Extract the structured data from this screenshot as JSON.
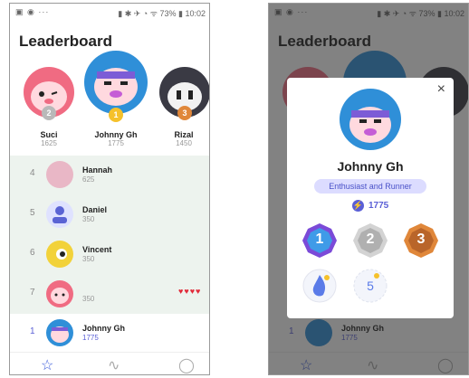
{
  "status_bar": {
    "left_icons": "▣ ◉ ···",
    "battery": "73%",
    "time": "10:02"
  },
  "title": "Leaderboard",
  "podium": [
    {
      "name": "Suci",
      "score": "1625",
      "rank": "2",
      "avatar_color": "#f06b82",
      "medal_color": "#b9b9b9"
    },
    {
      "name": "Johnny Gh",
      "score": "1775",
      "rank": "1",
      "avatar_color": "#2f8fd8",
      "medal_color": "#f5c12b"
    },
    {
      "name": "Rizal",
      "score": "1450",
      "rank": "3",
      "avatar_color": "#3a3a44",
      "medal_color": "#e0873a"
    }
  ],
  "list": [
    {
      "rank": "4",
      "name": "Hannah",
      "score": "625",
      "avatar_color": "#e9b7c6"
    },
    {
      "rank": "5",
      "name": "Daniel",
      "score": "350",
      "avatar_color": "#5a63d4"
    },
    {
      "rank": "6",
      "name": "Vincent",
      "score": "350",
      "avatar_color": "#f2d23a"
    },
    {
      "rank": "7",
      "name": "",
      "score": "350",
      "avatar_color": "#f06b82"
    }
  ],
  "hearts": "♥♥♥♥",
  "current_user": {
    "rank": "1",
    "name": "Johnny Gh",
    "score": "1775"
  },
  "colors": {
    "accent": "#5a5fd6",
    "list_bg": "#edf3ee"
  },
  "nav": [
    "star-icon",
    "activity-icon",
    "user-icon"
  ],
  "modal": {
    "name": "Johnny Gh",
    "subtitle": "Enthusiast and Runner",
    "points": "1775",
    "close": "×",
    "badges": [
      "1",
      "2",
      "3"
    ],
    "streak": "5"
  }
}
